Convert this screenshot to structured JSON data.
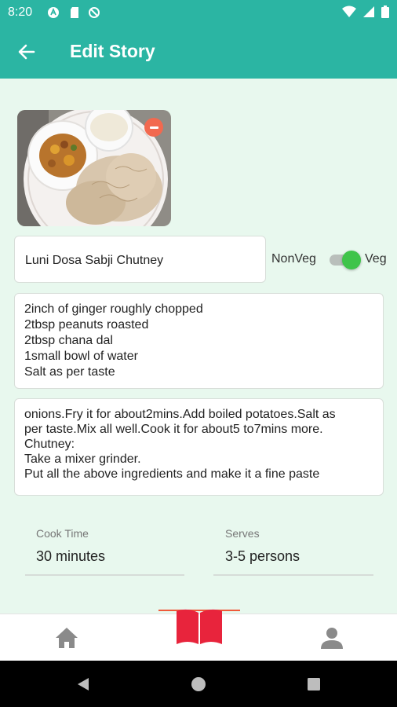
{
  "status_bar": {
    "time": "8:20",
    "left_icons": [
      "app-a-icon",
      "sd-card-icon",
      "blocked-icon"
    ],
    "right_icons": [
      "wifi-icon",
      "signal-icon",
      "battery-icon"
    ]
  },
  "app_bar": {
    "title": "Edit Story",
    "color": "#2bb5a3"
  },
  "story": {
    "name": "Luni Dosa Sabji Chutney",
    "diet_toggle": {
      "left_label": "NonVeg",
      "right_label": "Veg",
      "selected": "Veg"
    },
    "ingredients": [
      "2inch of ginger roughly chopped",
      "2tbsp peanuts roasted",
      "2tbsp chana dal",
      "1small bowl of water",
      "Salt as per taste"
    ],
    "steps": [
      "onions.Fry it for about2mins.Add boiled potatoes.Salt as",
      "per taste.Mix all well.Cook it for about5 to7mins more.",
      "Chutney:",
      "Take a mixer grinder.",
      "Put all the above ingredients and make it a fine paste"
    ],
    "cook_time": {
      "label": "Cook Time",
      "value": "30 minutes"
    },
    "serves": {
      "label": "Serves",
      "value": "3-5 persons"
    }
  },
  "bottom_nav": {
    "items": [
      "home-icon",
      "book-icon",
      "person-icon"
    ],
    "active": "book-icon",
    "active_color": "#e8243c"
  },
  "system_nav": [
    "back-triangle-icon",
    "home-circle-icon",
    "recents-square-icon"
  ]
}
